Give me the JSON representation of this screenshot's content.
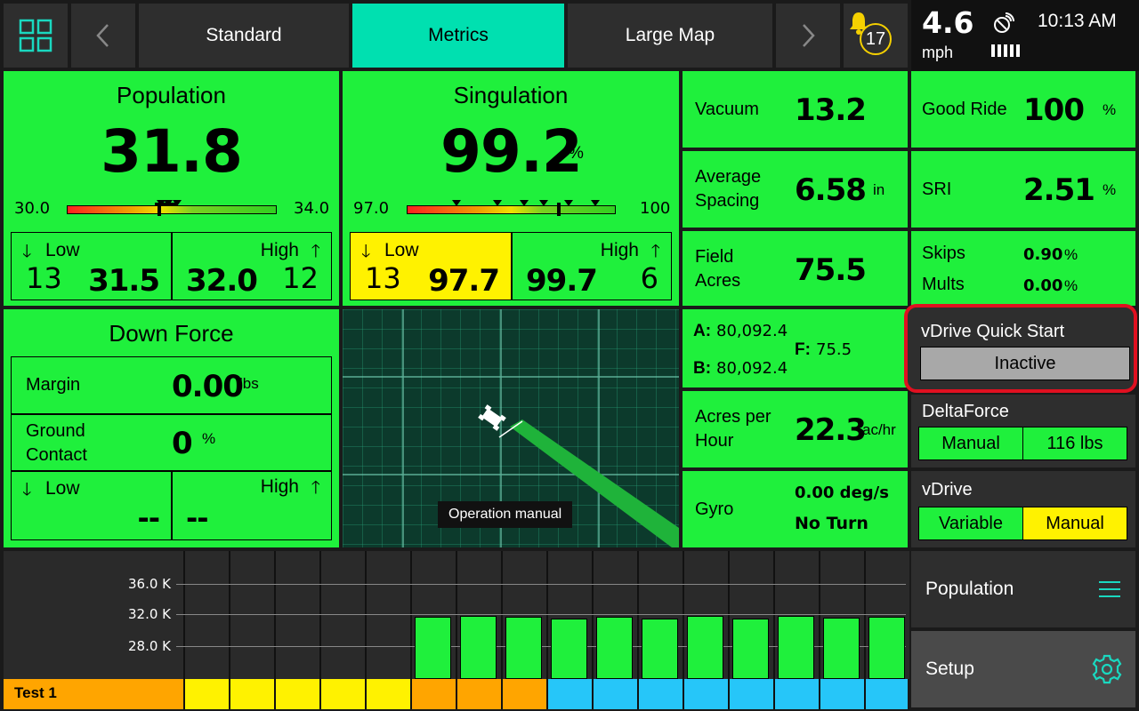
{
  "topbar": {
    "tabs": [
      {
        "label": "Standard",
        "active": false
      },
      {
        "label": "Metrics",
        "active": true
      },
      {
        "label": "Large Map",
        "active": false
      }
    ],
    "alert_count": "17",
    "speed": "4.6",
    "speed_unit": "mph",
    "time": "10:13 AM"
  },
  "population": {
    "title": "Population",
    "value": "31.8",
    "min": "30.0",
    "max": "34.0",
    "low_label": "Low",
    "low_count": "13",
    "low_value": "31.5",
    "high_label": "High",
    "high_value": "32.0",
    "high_count": "12"
  },
  "singulation": {
    "title": "Singulation",
    "value": "99.2",
    "unit": "%",
    "min": "97.0",
    "max": "100",
    "low_label": "Low",
    "low_count": "13",
    "low_value": "97.7",
    "high_label": "High",
    "high_value": "99.7",
    "high_count": "6"
  },
  "vacuum": {
    "label": "Vacuum",
    "value": "13.2"
  },
  "avg_spacing": {
    "label_1": "Average",
    "label_2": "Spacing",
    "value": "6.58",
    "unit": "in"
  },
  "field_acres": {
    "label_1": "Field",
    "label_2": "Acres",
    "value": "75.5"
  },
  "ab": {
    "a_label": "A:",
    "a_value": "80,092.4",
    "b_label": "B:",
    "b_value": "80,092.4",
    "f_label": "F:",
    "f_value": "75.5"
  },
  "acres_per_hour": {
    "label_1": "Acres per",
    "label_2": "Hour",
    "value": "22.3",
    "unit": "ac/hr"
  },
  "gyro": {
    "label": "Gyro",
    "value": "0.00 deg/s",
    "status": "No Turn"
  },
  "good_ride": {
    "label": "Good Ride",
    "value": "100",
    "unit": "%"
  },
  "sri": {
    "label": "SRI",
    "value": "2.51",
    "unit": "%"
  },
  "skips": {
    "skips_label": "Skips",
    "skips_value": "0.90",
    "mults_label": "Mults",
    "mults_value": "0.00",
    "unit": "%"
  },
  "vdrive_quick": {
    "title": "vDrive Quick Start",
    "state": "Inactive"
  },
  "deltaforce": {
    "title": "DeltaForce",
    "mode": "Manual",
    "value": "116 lbs"
  },
  "vdrive": {
    "title": "vDrive",
    "option_1": "Variable",
    "option_2": "Manual"
  },
  "down_force": {
    "title": "Down Force",
    "margin_label": "Margin",
    "margin_value": "0.00",
    "margin_unit": "lbs",
    "gc_label_1": "Ground",
    "gc_label_2": "Contact",
    "gc_value": "0",
    "gc_unit": "%",
    "low_label": "Low",
    "low_value": "--",
    "high_label": "High",
    "high_value": "--"
  },
  "map": {
    "tooltip": "Operation manual"
  },
  "row_chart": {
    "ticks": [
      "36.0 K",
      "32.0 K",
      "28.0 K"
    ],
    "row_name": "Test 1",
    "values": [
      null,
      null,
      null,
      null,
      null,
      31.8,
      31.9,
      31.8,
      31.6,
      31.8,
      31.6,
      31.9,
      31.5,
      31.9,
      31.7,
      31.8
    ],
    "status_colors": [
      "#ffa500",
      "#fff200",
      "#fff200",
      "#fff200",
      "#fff200",
      "#fff200",
      "#ffa500",
      "#ffa500",
      "#ffa500",
      "#26c6f9",
      "#26c6f9",
      "#26c6f9",
      "#26c6f9",
      "#26c6f9",
      "#26c6f9",
      "#26c6f9",
      "#26c6f9"
    ]
  },
  "side": {
    "population_label": "Population",
    "setup_label": "Setup"
  },
  "colors": {
    "green": "#1ff03c",
    "yellow": "#fff200",
    "teal": "#00e0b0",
    "red": "#e01020"
  }
}
